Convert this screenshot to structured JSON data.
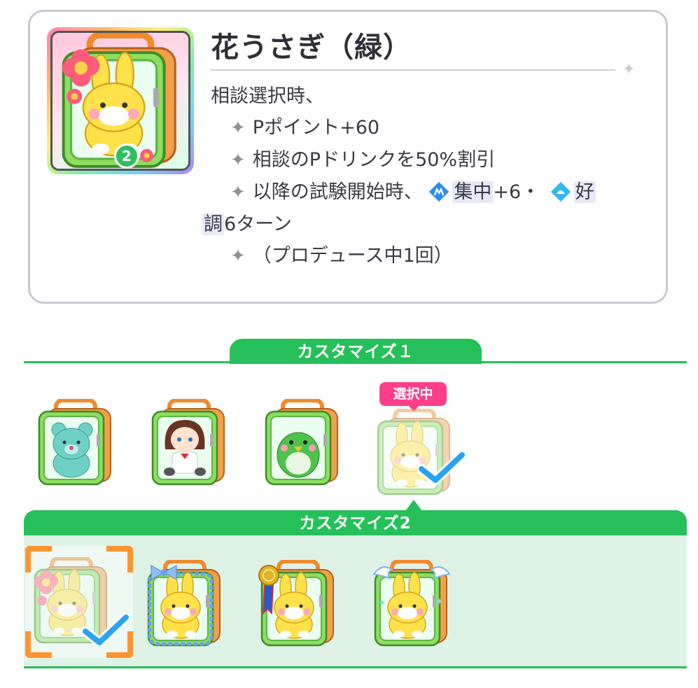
{
  "item": {
    "name": "花うさぎ（緑）",
    "level": "2",
    "effect": {
      "trigger": "相談選択時、",
      "line1": "Pポイント+60",
      "line2": "相談のPドリンクを50%割引",
      "line3_prefix": "以降の試験開始時、",
      "focus_keyword": "集中",
      "focus_value": "+6・",
      "good_keyword_part1": "好",
      "good_keyword_part2": "調",
      "good_suffix": "6ターン",
      "limit": "（プロデュース中1回）"
    }
  },
  "customize1": {
    "label": "カスタマイズ１",
    "selected_badge": "選択中",
    "options": [
      {
        "name": "bear",
        "mascot": "teal bear"
      },
      {
        "name": "girl",
        "mascot": "brown-haired girl doll"
      },
      {
        "name": "bird",
        "mascot": "green bird"
      },
      {
        "name": "rabbit",
        "mascot": "yellow rabbit",
        "selected": true
      }
    ]
  },
  "customize2": {
    "label": "カスタマイズ2",
    "options": [
      {
        "name": "flower",
        "selected": true
      },
      {
        "name": "blue-ribbon-frame"
      },
      {
        "name": "gold-medal"
      },
      {
        "name": "angel-wings"
      }
    ]
  },
  "colors": {
    "accent_green": "#25c05a",
    "selected_pink": "#ff3e8a",
    "selection_orange": "#ff9430",
    "check_blue": "#2aa3f0",
    "focus_icon": "#2a8ee8",
    "good_icon": "#35b7ef"
  },
  "icons": {
    "focus": "focus-icon",
    "good_condition": "good-condition-icon",
    "sparkle": "sparkle-icon",
    "check": "check-icon"
  }
}
